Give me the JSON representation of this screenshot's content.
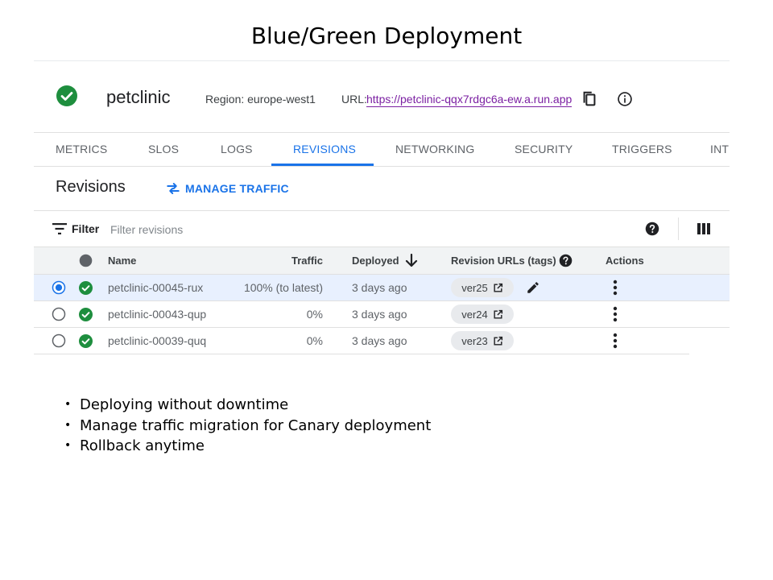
{
  "slide": {
    "title": "Blue/Green Deployment",
    "bullets": [
      "Deploying without downtime",
      "Manage traffic migration for Canary deployment",
      "Rollback anytime"
    ]
  },
  "service": {
    "name": "petclinic",
    "region": "Region: europe-west1",
    "url_label": "URL:",
    "url": "https://petclinic-qqx7rdgc6a-ew.a.run.app",
    "status": "ok"
  },
  "tabs": [
    "METRICS",
    "SLOS",
    "LOGS",
    "REVISIONS",
    "NETWORKING",
    "SECURITY",
    "TRIGGERS",
    "INT"
  ],
  "active_tab": "REVISIONS",
  "revisions_panel": {
    "title": "Revisions",
    "manage_traffic_label": "MANAGE TRAFFIC",
    "filter_label": "Filter",
    "filter_placeholder": "Filter revisions"
  },
  "table": {
    "columns": {
      "name": "Name",
      "traffic": "Traffic",
      "deployed": "Deployed",
      "urls": "Revision URLs (tags)",
      "actions": "Actions"
    },
    "sort_column": "Deployed",
    "sort_direction": "descending",
    "rows": [
      {
        "name": "petclinic-00045-rux",
        "traffic": "100% (to latest)",
        "deployed": "3 days ago",
        "tag": "ver25",
        "selected": true,
        "editable": true
      },
      {
        "name": "petclinic-00043-qup",
        "traffic": "0%",
        "deployed": "3 days ago",
        "tag": "ver24",
        "selected": false,
        "editable": false
      },
      {
        "name": "petclinic-00039-quq",
        "traffic": "0%",
        "deployed": "3 days ago",
        "tag": "ver23",
        "selected": false,
        "editable": false
      }
    ]
  },
  "colors": {
    "accent": "#1a73e8",
    "success": "#1e8e3e",
    "link": "#7b1fa2",
    "selected_row": "#e8f0fe",
    "header_bg": "#f1f3f4"
  },
  "icons": {
    "status": "check-circle-icon",
    "copy": "copy-icon",
    "info": "info-icon",
    "manage_traffic": "swap-arrows-icon",
    "filter": "filter-icon",
    "help": "help-icon",
    "columns": "column-display-icon",
    "sort": "arrow-down-icon",
    "external": "open-in-new-icon",
    "edit": "pencil-icon",
    "more": "more-vert-icon"
  }
}
